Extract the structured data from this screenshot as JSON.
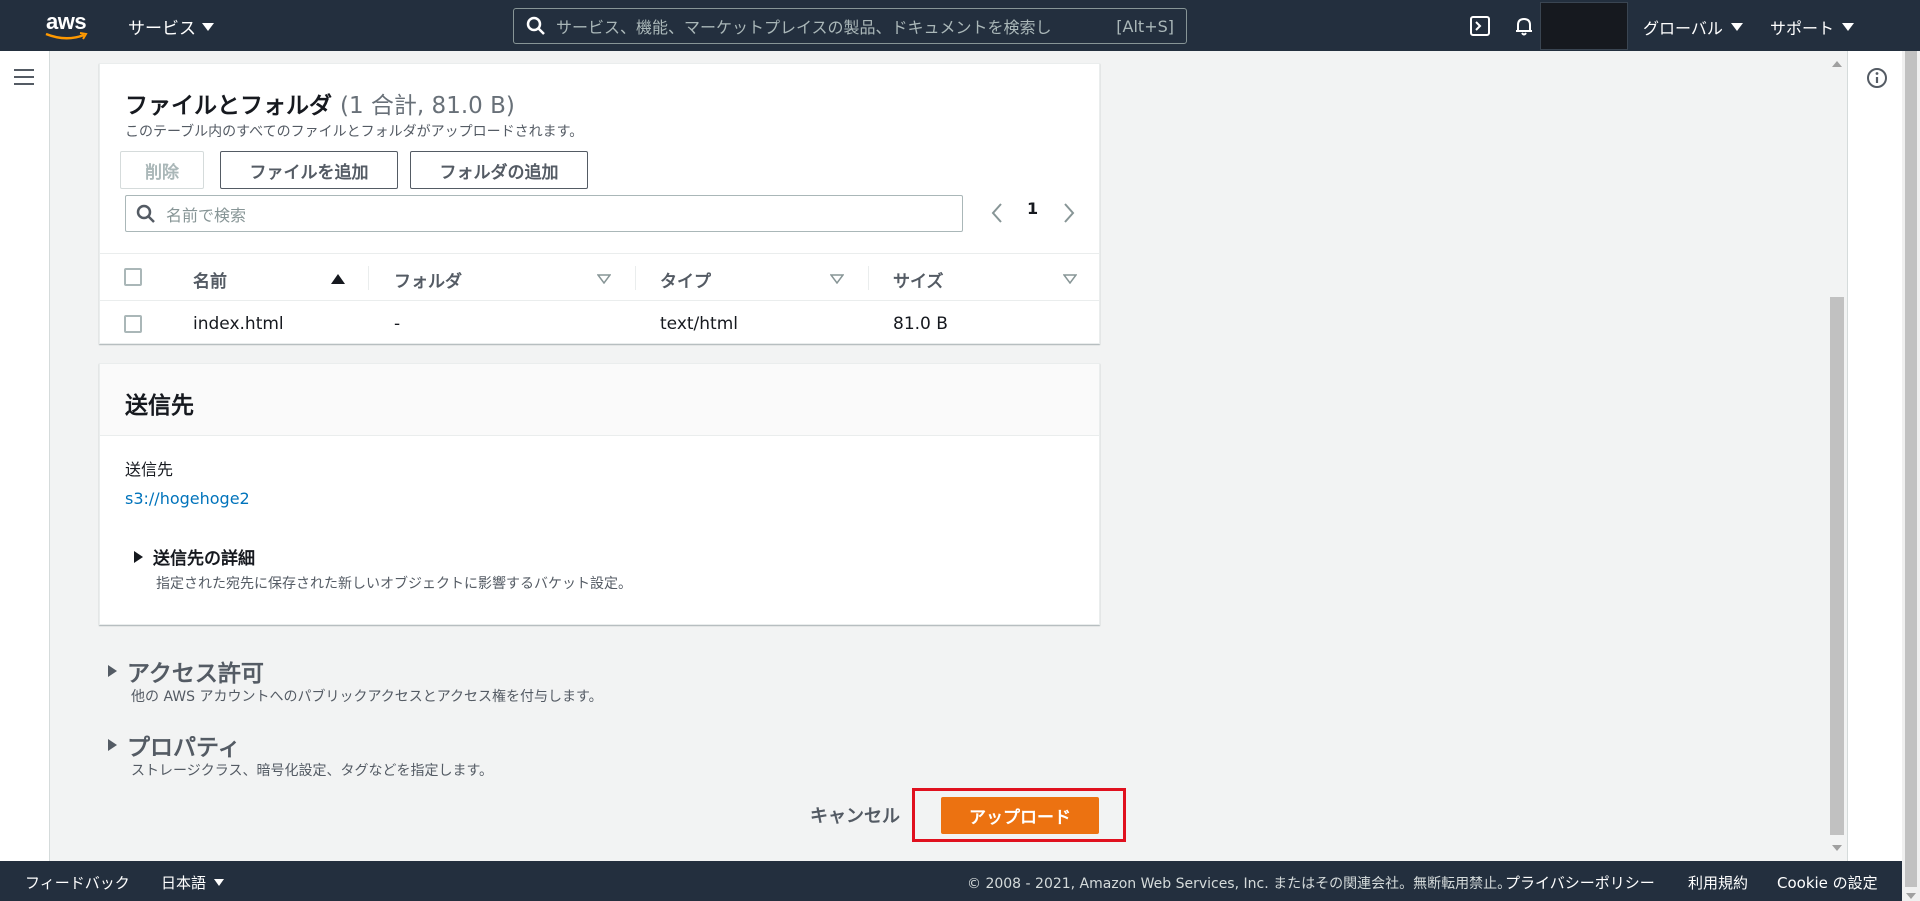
{
  "topnav": {
    "logo_text": "aws",
    "services_label": "サービス",
    "search_placeholder": "サービス、機能、マーケットプレイスの製品、ドキュメントを検索し",
    "search_shortcut": "[Alt+S]",
    "region_label": "グローバル",
    "support_label": "サポート"
  },
  "files_panel": {
    "title": "ファイルとフォルダ",
    "counter": "(1 合計, 81.0 B)",
    "description": "このテーブル内のすべてのファイルとフォルダがアップロードされます。",
    "delete_label": "削除",
    "add_files_label": "ファイルを追加",
    "add_folder_label": "フォルダの追加",
    "filter_placeholder": "名前で検索",
    "current_page": "1",
    "columns": [
      "名前",
      "フォルダ",
      "タイプ",
      "サイズ"
    ],
    "rows": [
      {
        "name": "index.html",
        "folder": "-",
        "type": "text/html",
        "size": "81.0 B"
      }
    ]
  },
  "destination_panel": {
    "title": "送信先",
    "label": "送信先",
    "value": "s3://hogehoge2",
    "details_title": "送信先の詳細",
    "details_desc": "指定された宛先に保存された新しいオブジェクトに影響するバケット設定。"
  },
  "permissions": {
    "title": "アクセス許可",
    "description": "他の AWS アカウントへのパブリックアクセスとアクセス権を付与します。"
  },
  "properties": {
    "title": "プロパティ",
    "description": "ストレージクラス、暗号化設定、タグなどを指定します。"
  },
  "actions": {
    "cancel_label": "キャンセル",
    "upload_label": "アップロード"
  },
  "footer": {
    "feedback": "フィードバック",
    "language": "日本語",
    "copyright": "© 2008 - 2021, Amazon Web Services, Inc. またはその関連会社。無断転用禁止。",
    "privacy": "プライバシーポリシー",
    "terms": "利用規約",
    "cookies": "Cookie の設定"
  },
  "colors": {
    "nav_bg": "#232f3e",
    "primary_button": "#ec7211",
    "link": "#0073bb",
    "highlight": "#e0101e"
  }
}
